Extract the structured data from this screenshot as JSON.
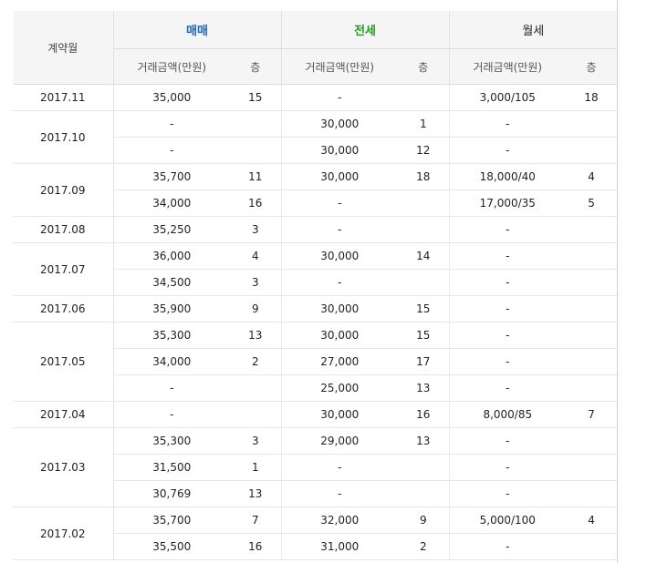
{
  "header": {
    "month": "계약월",
    "sale": "매매",
    "jeonse": "전세",
    "wolse": "월세",
    "price": "거래금액(만원)",
    "floor": "층"
  },
  "colors": {
    "sale": "#1a63c6",
    "jeonse": "#1fa01f"
  },
  "groups": [
    {
      "month": "2017.11",
      "rows": [
        {
          "sale_price": "35,000",
          "sale_floor": "15",
          "jeonse_price": "-",
          "jeonse_floor": "",
          "wolse_price": "3,000/105",
          "wolse_floor": "18"
        }
      ]
    },
    {
      "month": "2017.10",
      "rows": [
        {
          "sale_price": "-",
          "sale_floor": "",
          "jeonse_price": "30,000",
          "jeonse_floor": "1",
          "wolse_price": "-",
          "wolse_floor": ""
        },
        {
          "sale_price": "-",
          "sale_floor": "",
          "jeonse_price": "30,000",
          "jeonse_floor": "12",
          "wolse_price": "-",
          "wolse_floor": ""
        }
      ]
    },
    {
      "month": "2017.09",
      "rows": [
        {
          "sale_price": "35,700",
          "sale_floor": "11",
          "jeonse_price": "30,000",
          "jeonse_floor": "18",
          "wolse_price": "18,000/40",
          "wolse_floor": "4"
        },
        {
          "sale_price": "34,000",
          "sale_floor": "16",
          "jeonse_price": "-",
          "jeonse_floor": "",
          "wolse_price": "17,000/35",
          "wolse_floor": "5"
        }
      ]
    },
    {
      "month": "2017.08",
      "rows": [
        {
          "sale_price": "35,250",
          "sale_floor": "3",
          "jeonse_price": "-",
          "jeonse_floor": "",
          "wolse_price": "-",
          "wolse_floor": ""
        }
      ]
    },
    {
      "month": "2017.07",
      "rows": [
        {
          "sale_price": "36,000",
          "sale_floor": "4",
          "jeonse_price": "30,000",
          "jeonse_floor": "14",
          "wolse_price": "-",
          "wolse_floor": ""
        },
        {
          "sale_price": "34,500",
          "sale_floor": "3",
          "jeonse_price": "-",
          "jeonse_floor": "",
          "wolse_price": "-",
          "wolse_floor": ""
        }
      ]
    },
    {
      "month": "2017.06",
      "rows": [
        {
          "sale_price": "35,900",
          "sale_floor": "9",
          "jeonse_price": "30,000",
          "jeonse_floor": "15",
          "wolse_price": "-",
          "wolse_floor": ""
        }
      ]
    },
    {
      "month": "2017.05",
      "rows": [
        {
          "sale_price": "35,300",
          "sale_floor": "13",
          "jeonse_price": "30,000",
          "jeonse_floor": "15",
          "wolse_price": "-",
          "wolse_floor": ""
        },
        {
          "sale_price": "34,000",
          "sale_floor": "2",
          "jeonse_price": "27,000",
          "jeonse_floor": "17",
          "wolse_price": "-",
          "wolse_floor": ""
        },
        {
          "sale_price": "-",
          "sale_floor": "",
          "jeonse_price": "25,000",
          "jeonse_floor": "13",
          "wolse_price": "-",
          "wolse_floor": ""
        }
      ]
    },
    {
      "month": "2017.04",
      "rows": [
        {
          "sale_price": "-",
          "sale_floor": "",
          "jeonse_price": "30,000",
          "jeonse_floor": "16",
          "wolse_price": "8,000/85",
          "wolse_floor": "7"
        }
      ]
    },
    {
      "month": "2017.03",
      "rows": [
        {
          "sale_price": "35,300",
          "sale_floor": "3",
          "jeonse_price": "29,000",
          "jeonse_floor": "13",
          "wolse_price": "-",
          "wolse_floor": ""
        },
        {
          "sale_price": "31,500",
          "sale_floor": "1",
          "jeonse_price": "-",
          "jeonse_floor": "",
          "wolse_price": "-",
          "wolse_floor": ""
        },
        {
          "sale_price": "30,769",
          "sale_floor": "13",
          "jeonse_price": "-",
          "jeonse_floor": "",
          "wolse_price": "-",
          "wolse_floor": ""
        }
      ]
    },
    {
      "month": "2017.02",
      "rows": [
        {
          "sale_price": "35,700",
          "sale_floor": "7",
          "jeonse_price": "32,000",
          "jeonse_floor": "9",
          "wolse_price": "5,000/100",
          "wolse_floor": "4"
        },
        {
          "sale_price": "35,500",
          "sale_floor": "16",
          "jeonse_price": "31,000",
          "jeonse_floor": "2",
          "wolse_price": "-",
          "wolse_floor": ""
        }
      ]
    }
  ]
}
